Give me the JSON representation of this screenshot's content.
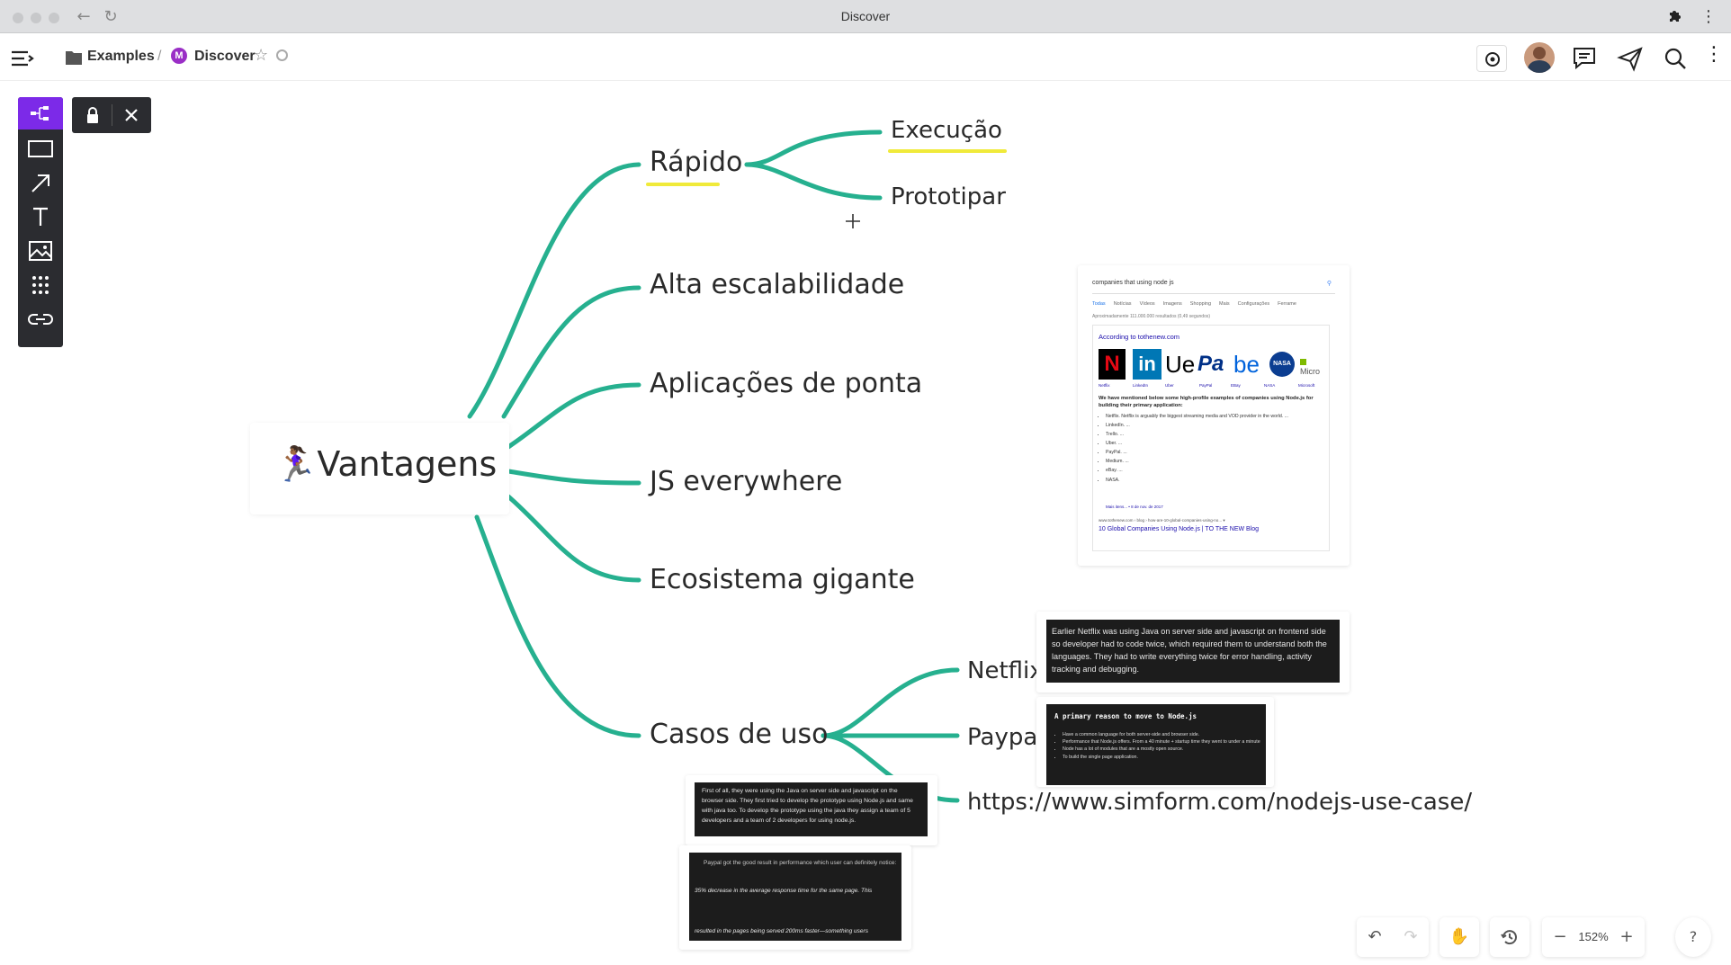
{
  "window": {
    "title": "Discover"
  },
  "breadcrumb": {
    "folder": "Examples",
    "separator": "/",
    "board_badge": "M",
    "board": "Discover"
  },
  "mindmap": {
    "root": "🏃🏾‍♀️Vantagens",
    "branches": [
      "Rápido",
      "Alta escalabilidade",
      "Aplicações de ponta",
      "JS everywhere",
      "Ecosistema gigante",
      "Casos de uso"
    ],
    "rapido_children": [
      "Execução",
      "Prototipar"
    ],
    "casos_children": [
      "Netflix",
      "Paypal",
      "https://www.simform.com/nodejs-use-case/"
    ],
    "line_color": "#26b08f",
    "highlight_color": "#f0ea3a"
  },
  "search_card": {
    "query": "companies that using node js",
    "tabs": [
      "Todas",
      "Notícias",
      "Vídeos",
      "Imagens",
      "Shopping",
      "Mais",
      "Configurações",
      "Ferrame"
    ],
    "results_count": "Aproximadamente 111.000.000 resultados (0,49 segundos)",
    "according": "According to tothenew.com",
    "logos": [
      "Netflix",
      "LinkedIn",
      "Uber",
      "PayPal",
      "EBay",
      "NASA",
      "Microsoft"
    ],
    "lead": "We have mentioned below some high-profile examples of companies using Node.js for building their primary application:",
    "bullets": [
      "Netflix. Netflix is arguably the biggest streaming media and VOD provider in the world. ...",
      "LinkedIn. ...",
      "Trello. ...",
      "Uber. ...",
      "PayPal. ...",
      "Medium. ...",
      "eBay. ...",
      "NASA."
    ],
    "more": "Mais itens... • 8 de nov. de 2017",
    "url": "www.tothenew.com › blog › how-are-10-global-companies-using-no... ▾",
    "link": "10 Global Companies Using Node.js | TO THE NEW Blog"
  },
  "netflix_card": {
    "text": "Earlier Netflix was using Java on server side and javascript on frontend side so developer had to code twice, which required them to understand both the languages. They had to write everything twice for error handling, activity tracking and debugging."
  },
  "reason_card": {
    "title": "A primary reason to move to Node.js",
    "items": [
      "Have a common language for both server-side and browser side.",
      "Performance that Node.js offers. From a 40 minute + startup time they went to under a minute",
      "Node has a lot of modules that are a mostly open source.",
      "To build the single page application."
    ]
  },
  "paypal_card1": {
    "text": "First of all, they were using the Java on server side and javascript on the browser side. They first tried to develop the prototype using Node.js and same with java too. To develop the prototype using the java they assign a team of 5 developers and a team of 2 developers for using node.js."
  },
  "paypal_card2": {
    "line1": "Paypal got the good result in performance which user can definitely notice:",
    "line2": "35% decrease in the average response time for the same page. This",
    "line3": "resulted in the pages being served 200ms faster—something users"
  },
  "zoom": {
    "level": "152%"
  },
  "help": "?"
}
